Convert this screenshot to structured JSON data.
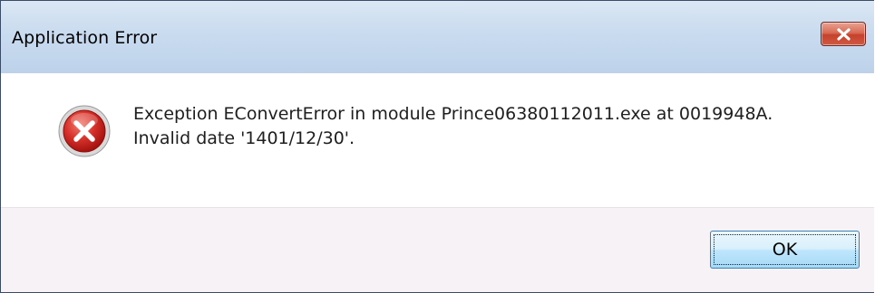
{
  "window": {
    "title": "Application Error"
  },
  "icons": {
    "close": "close-icon",
    "error": "error-icon"
  },
  "message": {
    "line1": "Exception EConvertError in module Prince06380112011.exe at 0019948A.",
    "line2": "Invalid date '1401/12/30'."
  },
  "buttons": {
    "ok_label": "OK"
  },
  "colors": {
    "titlebar": "#c9dbef",
    "close_button": "#c6412c",
    "error_icon": "#c81e1e",
    "footer": "#f7f2f5",
    "ok_button_border": "#3c7fb1"
  }
}
